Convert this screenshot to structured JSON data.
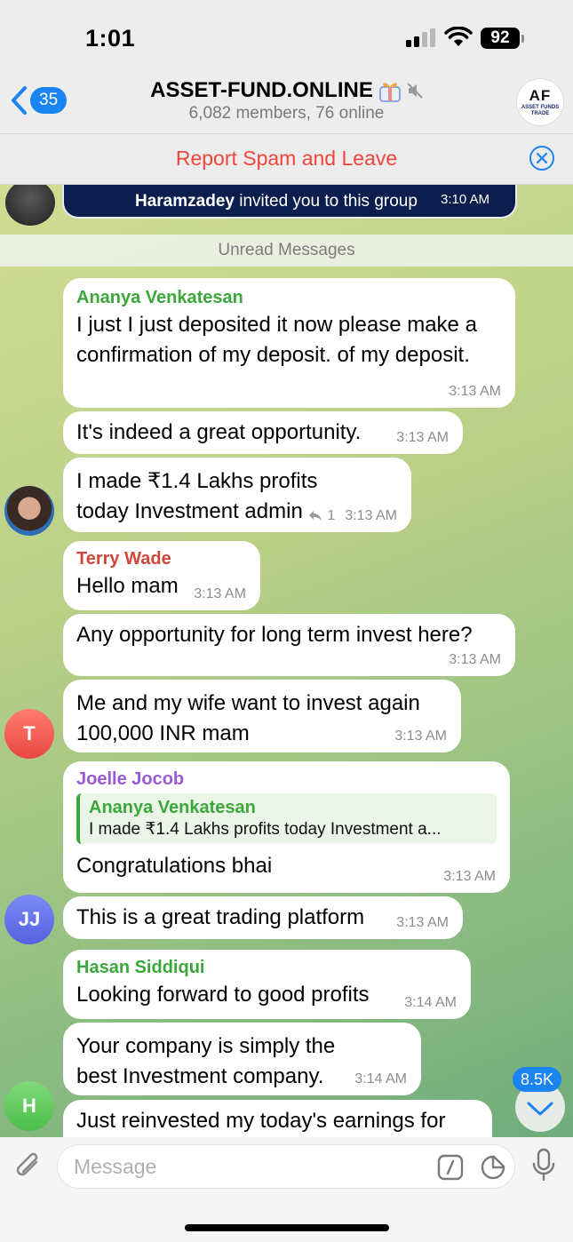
{
  "status_bar": {
    "time": "1:01",
    "battery": "92"
  },
  "header": {
    "back_count": "35",
    "title": "ASSET-FUND.ONLINE",
    "subtitle": "6,082 members, 76 online",
    "logo_text": "AF",
    "logo_subtext": "ASSET FUNDS TRADE"
  },
  "spam_bar": {
    "label": "Report Spam and Leave"
  },
  "invite": {
    "inviter": "Haramzadey",
    "text": " invited you to this group",
    "time": "3:10 AM"
  },
  "unread_label": "Unread Messages",
  "messages": [
    {
      "sender": "Ananya Venkatesan",
      "text": "I just I just deposited it now please make a confirmation of my deposit. of my deposit.",
      "time": "3:13 AM"
    },
    {
      "text": "It's indeed a great opportunity.",
      "time": "3:13 AM"
    },
    {
      "text": "I made ₹1.4 Lakhs profits today Investment admin",
      "replies": "1",
      "time": "3:13 AM"
    },
    {
      "sender": "Terry Wade",
      "text": "Hello mam",
      "time": "3:13 AM"
    },
    {
      "text": "Any opportunity for long term invest here?",
      "time": "3:13 AM"
    },
    {
      "text": "Me and my wife want to invest again 100,000 INR mam",
      "time": "3:13 AM",
      "avatar": "T"
    },
    {
      "sender": "Joelle Jocob",
      "quote_sender": "Ananya Venkatesan",
      "quote_text": "I made ₹1.4 Lakhs profits today Investment a...",
      "text": "Congratulations bhai",
      "time": "3:13 AM"
    },
    {
      "text": "This is a great trading platform",
      "time": "3:13 AM",
      "avatar": "JJ"
    },
    {
      "sender": "Hasan Siddiqui",
      "text": "Looking forward to good profits",
      "time": "3:14 AM"
    },
    {
      "text": "Your company is simply the best Investment company.",
      "time": "3:14 AM"
    },
    {
      "text": "Just reinvested my today's earnings for",
      "avatar": "H"
    }
  ],
  "scroll_badge": "8.5K",
  "input": {
    "placeholder": "Message"
  },
  "colors": {
    "accent": "#1a84f2",
    "spam": "#f0453a",
    "name_green": "#3ba73a",
    "name_red": "#d0473e",
    "name_purple": "#9a5ad6"
  }
}
